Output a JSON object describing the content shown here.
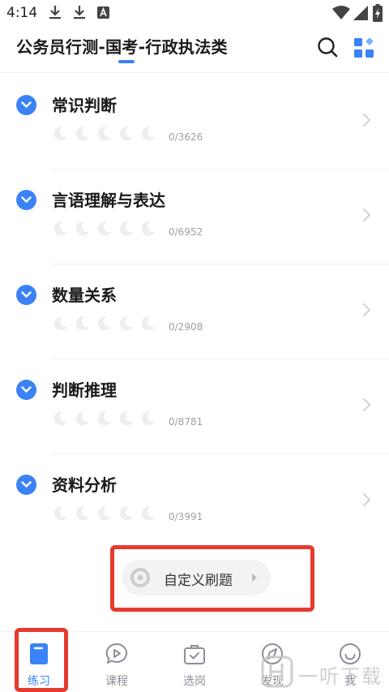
{
  "status_bar": {
    "time": "4:14"
  },
  "header": {
    "title": "公务员行测-国考-行政执法类"
  },
  "subjects": [
    {
      "name": "常识判断",
      "progress": "0/3626",
      "stars_filled": 0,
      "stars_total": 5
    },
    {
      "name": "言语理解与表达",
      "progress": "0/6952",
      "stars_filled": 0,
      "stars_total": 5
    },
    {
      "name": "数量关系",
      "progress": "0/2908",
      "stars_filled": 0,
      "stars_total": 5
    },
    {
      "name": "判断推理",
      "progress": "0/8781",
      "stars_filled": 0,
      "stars_total": 5
    },
    {
      "name": "资料分析",
      "progress": "0/3991",
      "stars_filled": 0,
      "stars_total": 5
    }
  ],
  "custom_practice": {
    "label": "自定义刷题"
  },
  "bottom_nav": [
    {
      "label": "练习",
      "icon": "book-icon",
      "active": true
    },
    {
      "label": "课程",
      "icon": "play-bubble-icon",
      "active": false
    },
    {
      "label": "选岗",
      "icon": "briefcase-check-icon",
      "active": false
    },
    {
      "label": "发现",
      "icon": "compass-icon",
      "active": false
    },
    {
      "label": "我",
      "icon": "smile-icon",
      "active": false
    }
  ],
  "watermark": {
    "text": "一听下载"
  },
  "colors": {
    "accent": "#3b82f6",
    "highlight": "#e53b2c",
    "muted": "#9aa0a6"
  }
}
